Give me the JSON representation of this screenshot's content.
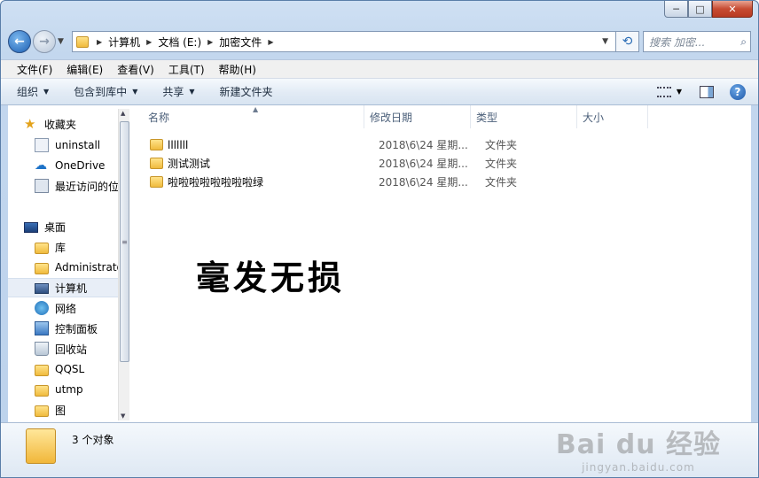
{
  "window": {
    "caption": {
      "minimize": "─",
      "maximize": "□",
      "close": "✕"
    }
  },
  "address": {
    "crumbs": [
      "计算机",
      "文档 (E:)",
      "加密文件"
    ],
    "search_placeholder": "搜索 加密..."
  },
  "menu": [
    "文件(F)",
    "编辑(E)",
    "查看(V)",
    "工具(T)",
    "帮助(H)"
  ],
  "commands": {
    "organize": "组织",
    "include_library": "包含到库中",
    "share": "共享",
    "new_folder": "新建文件夹"
  },
  "nav": {
    "favorites": "收藏夹",
    "favorites_items": [
      "uninstall",
      "OneDrive",
      "最近访问的位"
    ],
    "desktop": "桌面",
    "desktop_items": [
      "库",
      "Administrato",
      "计算机",
      "网络",
      "控制面板",
      "回收站",
      "QQSL",
      "utmp",
      "图"
    ]
  },
  "columns": {
    "name": "名称",
    "modified": "修改日期",
    "type": "类型",
    "size": "大小"
  },
  "files": [
    {
      "name": "lllllll",
      "modified": "2018\\6\\24 星期...",
      "type": "文件夹"
    },
    {
      "name": "测试测试",
      "modified": "2018\\6\\24 星期...",
      "type": "文件夹"
    },
    {
      "name": "啦啦啦啦啦啦啦啦绿",
      "modified": "2018\\6\\24 星期...",
      "type": "文件夹"
    }
  ],
  "overlay_text": "毫发无损",
  "watermark": {
    "logo": "Bai du 经验",
    "url": "jingyan.baidu.com"
  },
  "details": {
    "count": "3 个对象"
  },
  "icons": {
    "star": "star-icon",
    "computer": "computer-icon",
    "network": "network-icon"
  },
  "colors": {
    "accent": "#1c5fb3",
    "folder": "#f0bb3d",
    "chrome": "#c3d7ee"
  }
}
